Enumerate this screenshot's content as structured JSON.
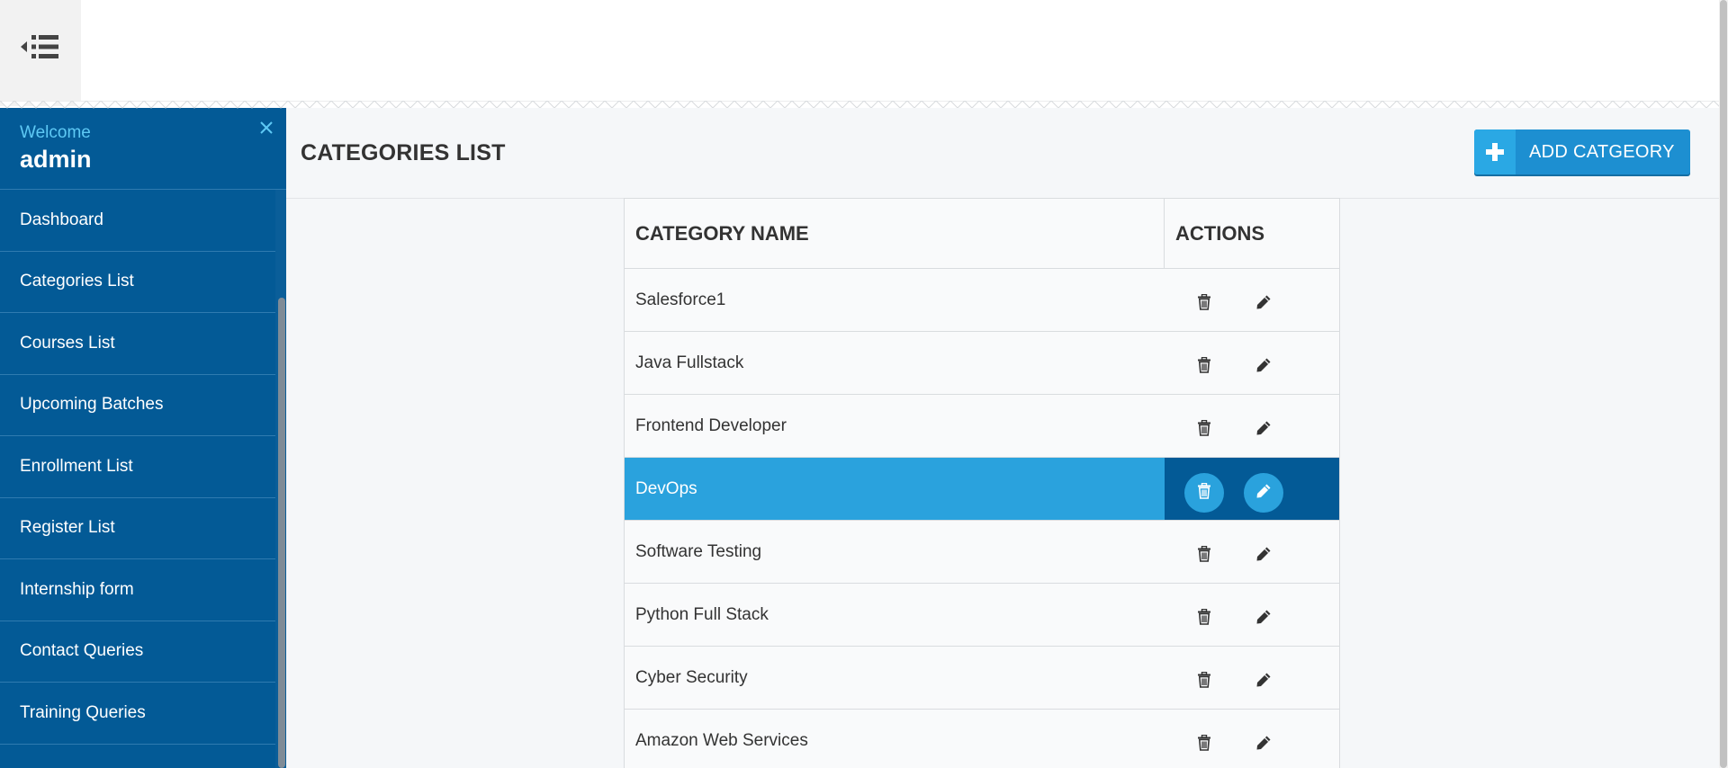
{
  "header": {
    "menu_toggle_icon": "menu-collapse-icon"
  },
  "sidebar": {
    "welcome": "Welcome",
    "username": "admin",
    "close_icon": "close-icon",
    "items": [
      {
        "label": "Dashboard"
      },
      {
        "label": "Categories List"
      },
      {
        "label": "Courses List"
      },
      {
        "label": "Upcoming Batches"
      },
      {
        "label": "Enrollment List"
      },
      {
        "label": "Register List"
      },
      {
        "label": "Internship form"
      },
      {
        "label": "Contact Queries"
      },
      {
        "label": "Training Queries"
      }
    ]
  },
  "main": {
    "title": "CATEGORIES LIST",
    "add_button": "ADD CATGEORY"
  },
  "table": {
    "columns": [
      "CATEGORY NAME",
      "ACTIONS"
    ],
    "rows": [
      {
        "name": "Salesforce1"
      },
      {
        "name": "Java Fullstack"
      },
      {
        "name": "Frontend Developer"
      },
      {
        "name": "DevOps",
        "highlighted": true
      },
      {
        "name": "Software Testing"
      },
      {
        "name": "Python Full Stack"
      },
      {
        "name": "Cyber Security"
      },
      {
        "name": "Amazon Web Services"
      }
    ]
  },
  "colors": {
    "sidebar_bg": "#035a96",
    "accent": "#2aa2dd",
    "welcome_text": "#5ec9f5",
    "button_bg": "#1d8fd1"
  }
}
